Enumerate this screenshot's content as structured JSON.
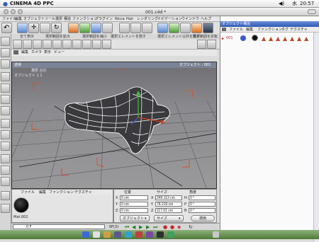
{
  "menubar": {
    "app_name": "CINEMA 4D PPC",
    "items": [
      "ファイル",
      "編集",
      "オブジェクト",
      "ツール",
      "選択",
      "構造",
      "ファンクション",
      "プラグイン",
      "Nicca",
      "Hair",
      "レンダリング",
      "ナビゲーション",
      "ウインドウ",
      "ヘルプ"
    ],
    "clock_day": "水",
    "clock_time": "20:57"
  },
  "window": {
    "title": "001.c4d *"
  },
  "toolbar_labels": [
    "全て表示",
    "選択範囲を拡大",
    "選択範囲を縮小",
    "選択エレメントを隠す",
    "選択エレメント以外を隠す",
    "選択範囲を反転"
  ],
  "viewport": {
    "menu": [
      "編集",
      "カメラ",
      "表示",
      "ビュー"
    ],
    "header_left": "透視",
    "header_right": "オブジェクト : 001",
    "info_labels": "選択 合計",
    "info_values": "オブジェクト 1 1"
  },
  "object_manager": {
    "tabs": [
      "オブジェクト",
      "構造"
    ],
    "menu": [
      "ファイル",
      "編集",
      "ファンクション",
      "タグ",
      "テクスチャ"
    ],
    "object_name": "001"
  },
  "material_manager": {
    "menu": [
      "ファイル",
      "編集",
      "ファンクション",
      "テクスチャ"
    ],
    "material_name": "Mat.002"
  },
  "coordinates": {
    "col_headers": [
      "位置",
      "サイズ",
      "角度"
    ],
    "rows": [
      {
        "axis": "X",
        "pos": "0 cm",
        "size_axis": "X",
        "size": "249.113 cm",
        "rot_axis": "H",
        "rot": "0 °"
      },
      {
        "axis": "Y",
        "pos": "0 cm",
        "size_axis": "Y",
        "size": "78.219 cm",
        "rot_axis": "P",
        "rot": "0 °"
      },
      {
        "axis": "Z",
        "pos": "0 cm",
        "size_axis": "Z",
        "size": "117.01 cm",
        "rot_axis": "B",
        "rot": "0 °"
      }
    ],
    "mode_select": "オブジェクト",
    "size_select": "サイズ",
    "apply_label": "適用"
  },
  "timeline": {
    "frame_field": "0 F",
    "frame_end": "0F(3)"
  },
  "colors": {
    "menubar": "#eeeeee",
    "panel_header": "#3a64c0",
    "viewport_bg": "#8a8a8e",
    "mesh": "#ffffff",
    "dock": "#4f7a3a"
  }
}
